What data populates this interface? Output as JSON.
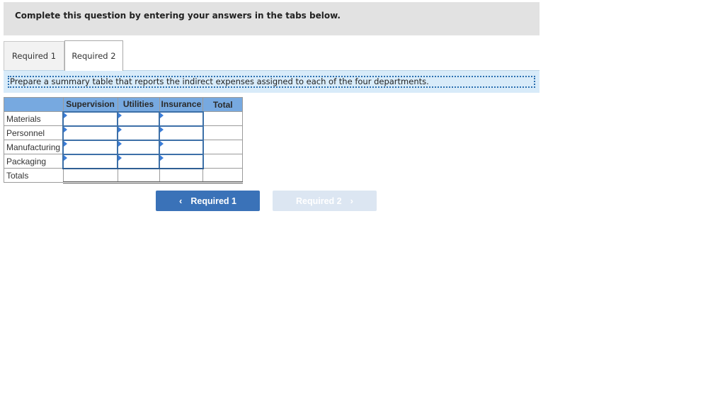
{
  "instructions": {
    "text": "Complete this question by entering your answers in the tabs below."
  },
  "tabs": [
    {
      "label": "Required 1",
      "active": false
    },
    {
      "label": "Required 2",
      "active": true
    }
  ],
  "prompt": {
    "text": "Prepare a summary table that reports the indirect expenses assigned to each of the four departments."
  },
  "table": {
    "columns": [
      "",
      "Supervision",
      "Utilities",
      "Insurance",
      "Total"
    ],
    "rows": [
      {
        "label": "Materials",
        "supervision": "",
        "utilities": "",
        "insurance": "",
        "total": ""
      },
      {
        "label": "Personnel",
        "supervision": "",
        "utilities": "",
        "insurance": "",
        "total": ""
      },
      {
        "label": "Manufacturing",
        "supervision": "",
        "utilities": "",
        "insurance": "",
        "total": ""
      },
      {
        "label": "Packaging",
        "supervision": "",
        "utilities": "",
        "insurance": "",
        "total": ""
      }
    ],
    "totals": {
      "label": "Totals",
      "supervision": "",
      "utilities": "",
      "insurance": "",
      "total": ""
    }
  },
  "nav": {
    "prev": {
      "label": "Required 1",
      "icon": "chevron-left-icon",
      "glyph": "‹"
    },
    "next": {
      "label": "Required 2",
      "icon": "chevron-right-icon",
      "glyph": "›",
      "disabled": true
    }
  }
}
